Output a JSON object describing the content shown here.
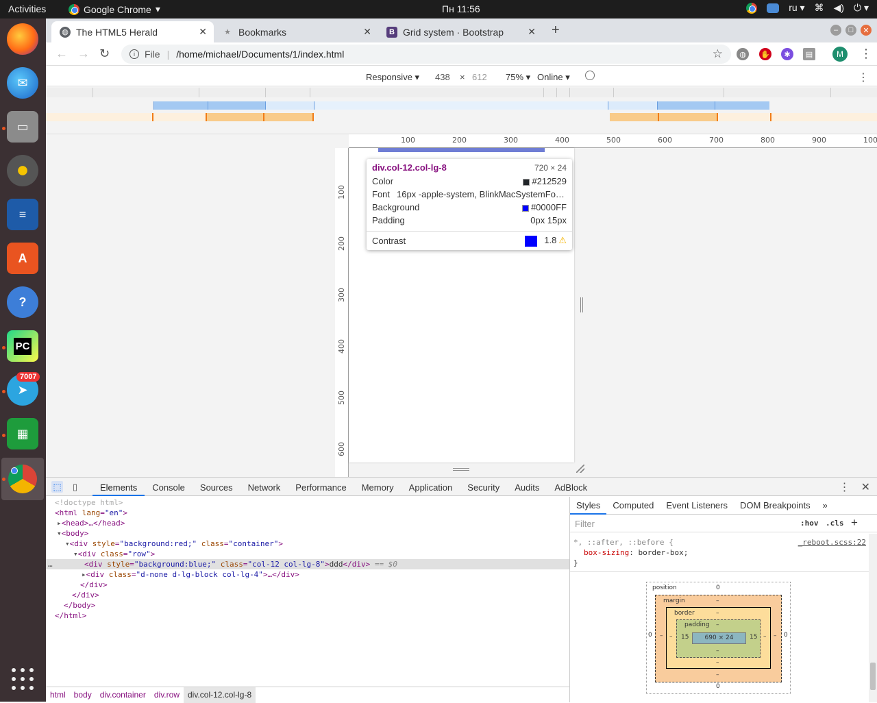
{
  "topbar": {
    "activities": "Activities",
    "app_name": "Google Chrome",
    "clock": "Пн 11:56",
    "lang": "ru"
  },
  "dock": {
    "badge_count": "7007",
    "apps": [
      "firefox-icon",
      "thunderbird-icon",
      "files-icon",
      "rhythmbox-icon",
      "writer-icon",
      "software-center-icon",
      "help-icon",
      "pycharm-icon",
      "telegram-icon",
      "calc-icon",
      "chrome-icon"
    ]
  },
  "browser": {
    "tabs": [
      {
        "title": "The HTML5 Herald",
        "active": true
      },
      {
        "title": "Bookmarks",
        "active": false
      },
      {
        "title": "Grid system · Bootstrap",
        "active": false
      }
    ],
    "omnibox": {
      "scheme": "File",
      "url": "/home/michael/Documents/1/index.html"
    },
    "avatar_letter": "M"
  },
  "device_toolbar": {
    "mode": "Responsive",
    "width": "438",
    "times": "×",
    "height": "612",
    "zoom": "75%",
    "network": "Online"
  },
  "rulers": {
    "top_labels": [
      "100",
      "200",
      "300",
      "400",
      "500",
      "600",
      "700",
      "800",
      "900",
      "100"
    ],
    "left_labels": [
      "100",
      "200",
      "300",
      "400",
      "500",
      "600"
    ]
  },
  "tooltip": {
    "selector": "div.col-12.col-lg-8",
    "size": "720 × 24",
    "color_label": "Color",
    "color_value": "#212529",
    "font_label": "Font",
    "font_value": "16px -apple-system, BlinkMacSystemFo…",
    "background_label": "Background",
    "background_value": "#0000FF",
    "padding_label": "Padding",
    "padding_value": "0px 15px",
    "contrast_label": "Contrast",
    "contrast_value": "1.8",
    "colors": {
      "color_swatch": "#212529",
      "bg_swatch": "#0000FF"
    }
  },
  "devtools": {
    "tabs": [
      "Elements",
      "Console",
      "Sources",
      "Network",
      "Performance",
      "Memory",
      "Application",
      "Security",
      "Audits",
      "AdBlock"
    ],
    "active_tab": "Elements",
    "dom": {
      "doctype": "<!doctype html>",
      "html_open_tag": "html",
      "html_attr": "lang",
      "html_val": "\"en\"",
      "head": "<head>…</head>",
      "body_open": "<body>",
      "container_tag": "div",
      "style_attr": "style",
      "container_style": "\"background:red;\"",
      "class_attr": "class",
      "container_class": "\"container\"",
      "row_class": "\"row\"",
      "col_style": "\"background:blue;\"",
      "col_class": "\"col-12 col-lg-8\"",
      "col_text": "ddd",
      "col_end": "</div>",
      "dollar": "== $0",
      "side_class": "\"d-none d-lg-block col-lg-4\"",
      "side_ellipsis": ">…</div>",
      "div_close": "</div>",
      "body_close": "</body>",
      "html_close": "</html>"
    },
    "breadcrumbs": [
      "html",
      "body",
      "div.container",
      "div.row",
      "div.col-12.col-lg-8"
    ],
    "styles_tabs": [
      "Styles",
      "Computed",
      "Event Listeners",
      "DOM Breakpoints"
    ],
    "filter_placeholder": "Filter",
    "hov": ":hov",
    "cls": ".cls",
    "rule": {
      "selector": "*, ::after, ::before {",
      "source": "_reboot.scss:22",
      "property": "box-sizing",
      "value": "border-box;",
      "close": "}"
    },
    "box_model": {
      "position_label": "position",
      "position_value": "0",
      "margin_label": "margin",
      "border_label": "border",
      "padding_label": "padding",
      "dash": "–",
      "content": "690 × 24",
      "padding_left": "15",
      "padding_right": "15",
      "side_zero": "0"
    }
  }
}
